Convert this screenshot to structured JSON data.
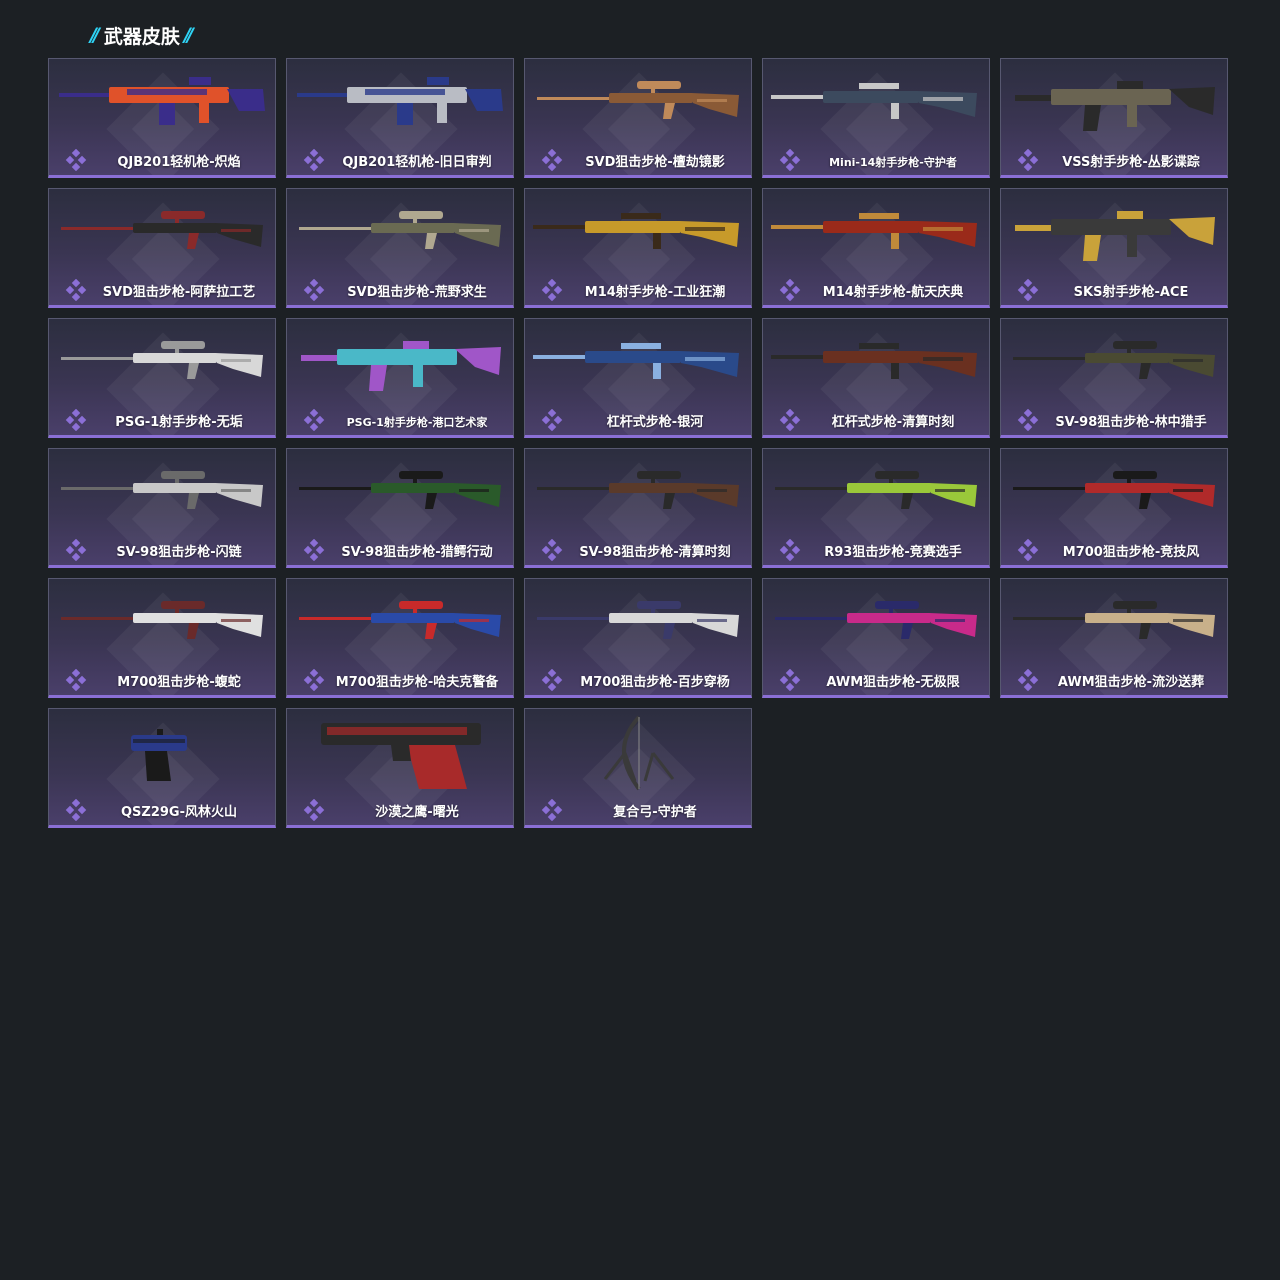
{
  "section": {
    "title": "武器皮肤",
    "accent_color": "#2ed3f5"
  },
  "rarity_color": "#8b6fd6",
  "skins": [
    {
      "name": "QJB201轻机枪-炽焰",
      "weapon": "lmg",
      "colors": [
        "#e0522a",
        "#3a2d8a"
      ]
    },
    {
      "name": "QJB201轻机枪-旧日审判",
      "weapon": "lmg",
      "colors": [
        "#b9bcc4",
        "#2a3a8a"
      ]
    },
    {
      "name": "SVD狙击步枪-檀劫镜影",
      "weapon": "sniper",
      "colors": [
        "#8a5a36",
        "#c08a5a"
      ]
    },
    {
      "name": "Mini-14射手步枪-守护者",
      "weapon": "rifle",
      "colors": [
        "#3c4a5e",
        "#c7c7c7"
      ]
    },
    {
      "name": "VSS射手步枪-丛影谍踪",
      "weapon": "assault",
      "colors": [
        "#6a6452",
        "#2a2a2a"
      ]
    },
    {
      "name": "SVD狙击步枪-阿萨拉工艺",
      "weapon": "sniper",
      "colors": [
        "#2a2a2a",
        "#8a2a2a"
      ]
    },
    {
      "name": "SVD狙击步枪-荒野求生",
      "weapon": "sniper",
      "colors": [
        "#6a6a52",
        "#b0a890"
      ]
    },
    {
      "name": "M14射手步枪-工业狂潮",
      "weapon": "rifle",
      "colors": [
        "#c79a2a",
        "#3a2a1a"
      ]
    },
    {
      "name": "M14射手步枪-航天庆典",
      "weapon": "rifle",
      "colors": [
        "#9a2a1a",
        "#c08a3a"
      ]
    },
    {
      "name": "SKS射手步枪-ACE",
      "weapon": "assault",
      "colors": [
        "#3a3a3a",
        "#c9a23a"
      ]
    },
    {
      "name": "PSG-1射手步枪-无垢",
      "weapon": "sniper",
      "colors": [
        "#d8d8d8",
        "#9a9a9a"
      ]
    },
    {
      "name": "PSG-1射手步枪-港口艺术家",
      "weapon": "assault",
      "colors": [
        "#4ab8c8",
        "#a056c8"
      ]
    },
    {
      "name": "杠杆式步枪-银河",
      "weapon": "rifle",
      "colors": [
        "#2a4a8a",
        "#8ab0e0"
      ]
    },
    {
      "name": "杠杆式步枪-清算时刻",
      "weapon": "rifle",
      "colors": [
        "#6a3020",
        "#2a2a2a"
      ]
    },
    {
      "name": "SV-98狙击步枪-林中猎手",
      "weapon": "sniper",
      "colors": [
        "#4a4a32",
        "#2a2a2a"
      ]
    },
    {
      "name": "SV-98狙击步枪-闪链",
      "weapon": "sniper",
      "colors": [
        "#c8c8c8",
        "#6a6a6a"
      ]
    },
    {
      "name": "SV-98狙击步枪-猎鳄行动",
      "weapon": "sniper",
      "colors": [
        "#2a5a2a",
        "#1a1a1a"
      ]
    },
    {
      "name": "SV-98狙击步枪-清算时刻",
      "weapon": "sniper",
      "colors": [
        "#5a3a2a",
        "#2a2a2a"
      ]
    },
    {
      "name": "R93狙击步枪-竞赛选手",
      "weapon": "sniper",
      "colors": [
        "#9ac83a",
        "#2a2a2a"
      ]
    },
    {
      "name": "M700狙击步枪-竞技风",
      "weapon": "sniper",
      "colors": [
        "#b02a2a",
        "#1a1a1a"
      ]
    },
    {
      "name": "M700狙击步枪-蝮蛇",
      "weapon": "sniper",
      "colors": [
        "#e0e0e0",
        "#6a2a2a"
      ]
    },
    {
      "name": "M700狙击步枪-哈夫克警备",
      "weapon": "sniper",
      "colors": [
        "#2a4aa8",
        "#c82a2a"
      ]
    },
    {
      "name": "M700狙击步枪-百步穿杨",
      "weapon": "sniper",
      "colors": [
        "#d8d8d8",
        "#3a3a6a"
      ]
    },
    {
      "name": "AWM狙击步枪-无极限",
      "weapon": "sniper",
      "colors": [
        "#c82a8a",
        "#2a2a6a"
      ]
    },
    {
      "name": "AWM狙击步枪-流沙送葬",
      "weapon": "sniper",
      "colors": [
        "#c8b08a",
        "#2a2a2a"
      ]
    },
    {
      "name": "QSZ29G-风林火山",
      "weapon": "pistol",
      "colors": [
        "#2a3a8a",
        "#1a1a1a"
      ]
    },
    {
      "name": "沙漠之鹰-曙光",
      "weapon": "deagle",
      "colors": [
        "#a82a2a",
        "#2a2a2a"
      ]
    },
    {
      "name": "复合弓-守护者",
      "weapon": "bow",
      "colors": [
        "#3a3a3a",
        "#8a8a8a"
      ]
    }
  ]
}
